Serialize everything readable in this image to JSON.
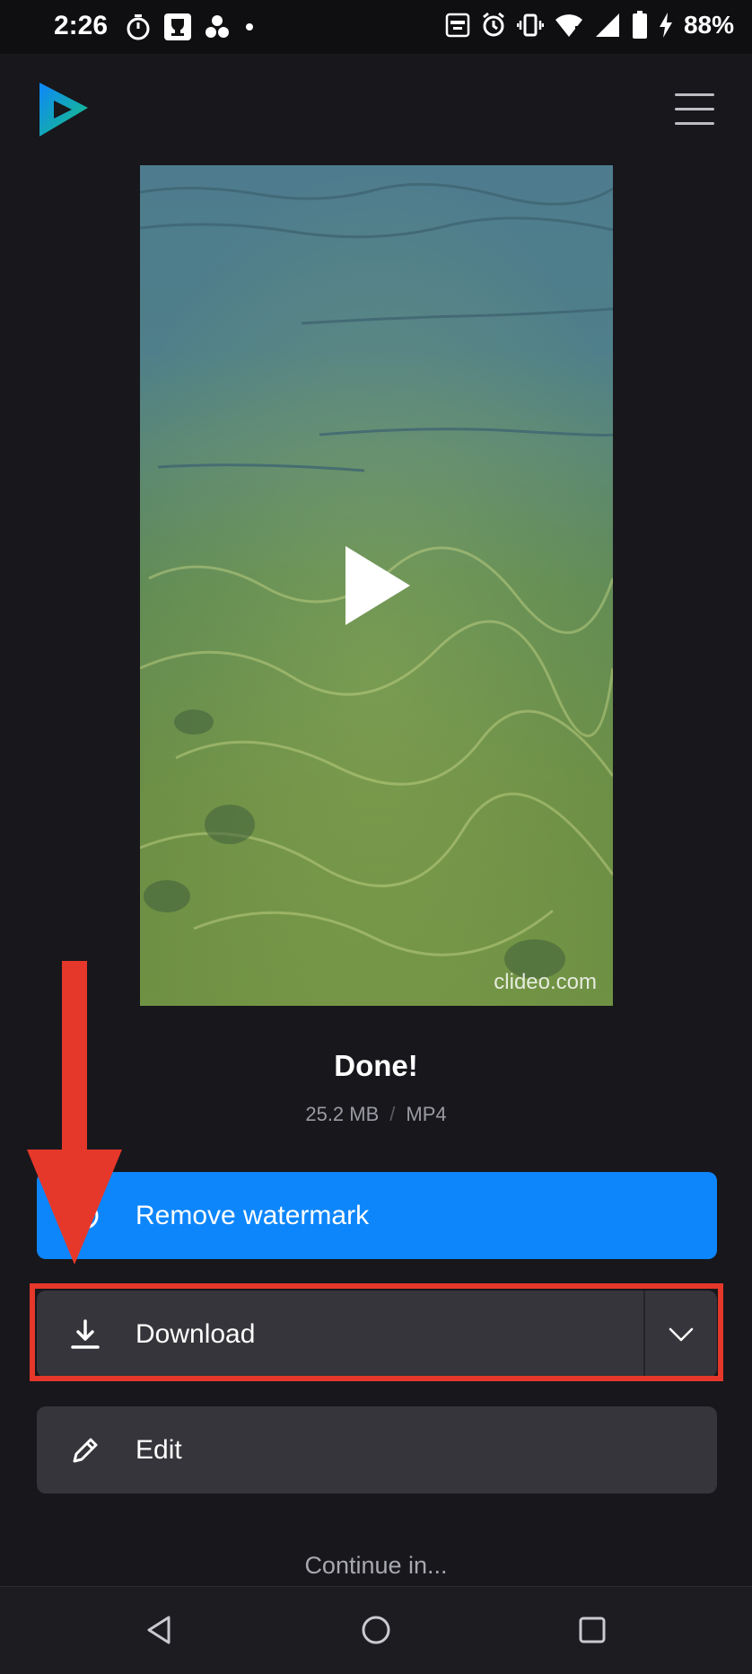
{
  "status_bar": {
    "time": "2:26",
    "battery_percent": "88%",
    "icons_left": [
      "timer-icon",
      "trophy-icon",
      "dots-icon",
      "dot-icon"
    ],
    "icons_right": [
      "auto-icon",
      "alarm-icon",
      "vibrate-icon",
      "wifi-icon",
      "signal-icon",
      "battery-icon",
      "charging-icon"
    ]
  },
  "header": {
    "logo": "clideo-logo",
    "menu_icon": "hamburger-menu-icon"
  },
  "video": {
    "watermark": "clideo.com",
    "play_icon": "play-icon"
  },
  "result": {
    "title": "Done!",
    "size": "25.2 MB",
    "separator": "/",
    "format": "MP4"
  },
  "actions": {
    "remove_watermark_label": "Remove watermark",
    "download_label": "Download",
    "edit_label": "Edit",
    "continue_label": "Continue in..."
  },
  "colors": {
    "background": "#17171c",
    "primary_button": "#0e86fb",
    "secondary_button": "#35353b",
    "annotation": "#e5382a"
  },
  "navbar": {
    "icons": [
      "back-icon",
      "home-icon",
      "recents-icon"
    ]
  }
}
